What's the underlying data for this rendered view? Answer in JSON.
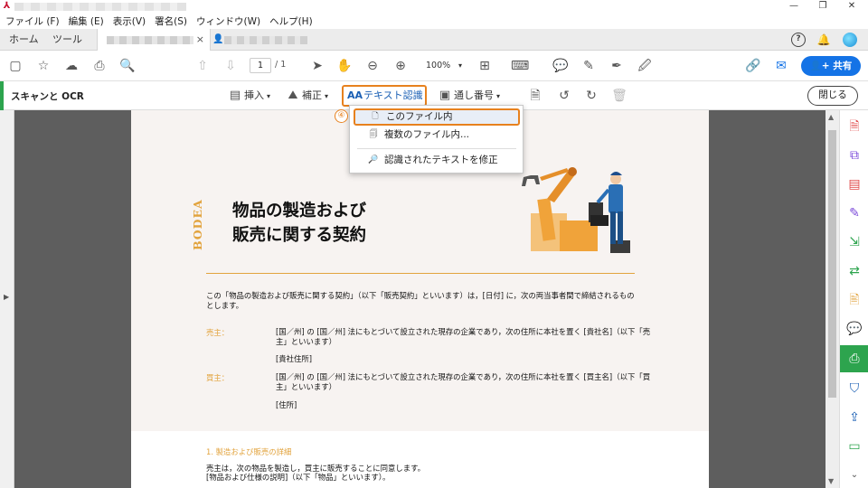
{
  "titlebar": {
    "minimize": "—",
    "restore": "❐",
    "close": "✕"
  },
  "menubar": {
    "items": [
      "ファイル (F)",
      "編集 (E)",
      "表示(V)",
      "署名(S)",
      "ウィンドウ(W)",
      "ヘルプ(H)"
    ]
  },
  "tabs": {
    "home": "ホーム",
    "tools": "ツール",
    "doc_tab_close": "×"
  },
  "toolbar": {
    "page_current": "1",
    "page_total": "/ 1",
    "zoom": "100%",
    "share_label": "共有"
  },
  "tools_bar": {
    "title": "スキャンと OCR",
    "insert": "挿入",
    "enhance": "補正",
    "recognize_text": "テキスト認識",
    "bates": "通し番号",
    "close": "閉じる"
  },
  "dropdown": {
    "step_number": "④",
    "items": [
      "このファイル内",
      "複数のファイル内...",
      "認識されたテキストを修正"
    ]
  },
  "document": {
    "brand": "BODEA",
    "title_line1": "物品の製造および",
    "title_line2": "販売に関する契約",
    "intro": "この「物品の製造および販売に関する契約」（以下「販売契約」といいます）は，[日付] に，次の両当事者間で締結されるものとします。",
    "seller_label": "売主：",
    "seller_text": "[国／州] の [国／州] 法にもとづいて設立された現存の企業であり，次の住所に本社を置く [貴社名]（以下「売主」といいます）",
    "seller_address": "[貴社住所]",
    "buyer_label": "買主：",
    "buyer_text": "[国／州] の [国／州] 法にもとづいて設立された現存の企業であり，次の住所に本社を置く [買主名]（以下「買主」といいます）",
    "buyer_address": "[住所]",
    "section1_title": "1. 製造および販売の詳細",
    "section1_line1": "売主は，次の物品を製造し，買主に販売することに同意します。",
    "section1_line2": "[物品および仕様の説明]（以下「物品」といいます）。"
  },
  "colors": {
    "accent_orange": "#e7811e",
    "brand_gold": "#e2a33d",
    "primary_blue": "#1473e6",
    "active_green": "#2da44e"
  }
}
